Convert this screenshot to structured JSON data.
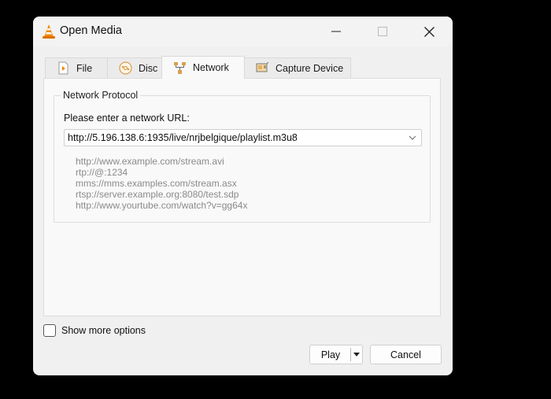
{
  "window": {
    "title": "Open Media",
    "icon": "vlc-cone-icon",
    "controls": [
      "minimize",
      "maximize",
      "close"
    ]
  },
  "tabs": [
    {
      "label": "File",
      "icon": "file-icon",
      "active": false
    },
    {
      "label": "Disc",
      "icon": "disc-icon",
      "active": false
    },
    {
      "label": "Network",
      "icon": "network-icon",
      "active": true
    },
    {
      "label": "Capture Device",
      "icon": "capture-device-icon",
      "active": false
    }
  ],
  "network": {
    "group_title": "Network Protocol",
    "url_label": "Please enter a network URL:",
    "url_value": "http://5.196.138.6:1935/live/nrjbelgique/playlist.m3u8",
    "examples": [
      "http://www.example.com/stream.avi",
      "rtp://@:1234",
      "mms://mms.examples.com/stream.asx",
      "rtsp://server.example.org:8080/test.sdp",
      "http://www.yourtube.com/watch?v=gg64x"
    ]
  },
  "options": {
    "show_more_label": "Show more options",
    "show_more_checked": false
  },
  "buttons": {
    "play": "Play",
    "cancel": "Cancel"
  }
}
